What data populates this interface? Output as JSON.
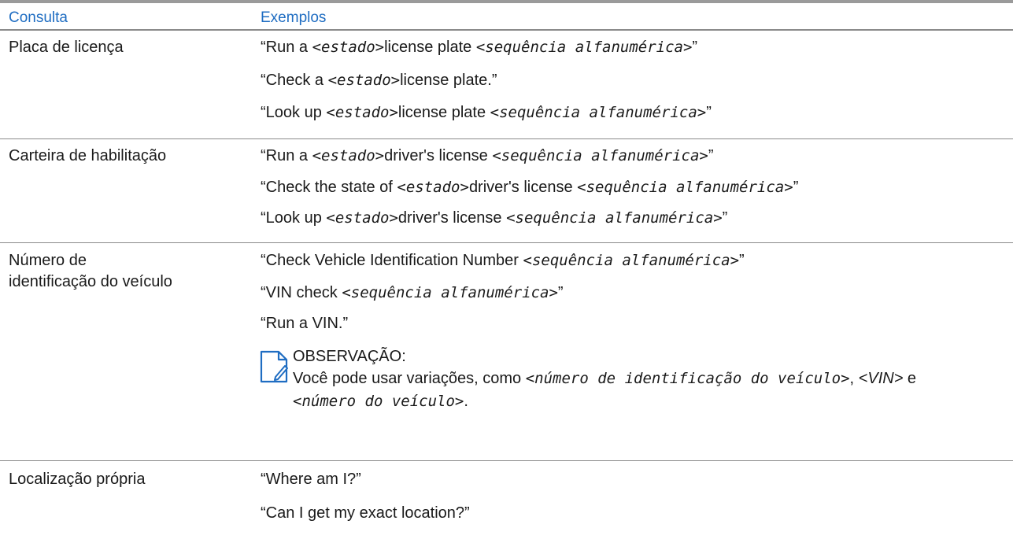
{
  "header": {
    "col1": "Consulta",
    "col2": "Exemplos"
  },
  "rows": [
    {
      "query": "Placa de licença",
      "examples": [
        {
          "pre": "“Run a ",
          "var1": "<estado>",
          "mid": "license plate ",
          "var2": "<sequência alfanumérica>",
          "post": "”"
        },
        {
          "pre": "“Check a ",
          "var1": "<estado>",
          "mid": "license plate.”"
        },
        {
          "pre": "“Look up ",
          "var1": "<estado>",
          "mid": "license plate ",
          "var2": "<sequência alfanumérica>",
          "post": "”"
        }
      ]
    },
    {
      "query": "Carteira de habilitação",
      "examples": [
        {
          "pre": "“Run a ",
          "var1": "<estado>",
          "mid": "driver's license ",
          "var2": "<sequência alfanumérica>",
          "post": "”"
        },
        {
          "pre": "“Check the state of ",
          "var1": "<estado>",
          "mid": "driver's license ",
          "var2": "<sequência alfanumérica>",
          "post": "”"
        },
        {
          "pre": "“Look up ",
          "var1": "<estado>",
          "mid": "driver's license ",
          "var2": "<sequência alfanumérica>",
          "post": "”"
        }
      ]
    },
    {
      "query_line1": "Número de",
      "query_line2": "identificação do veículo",
      "examples": [
        {
          "pre": "“Check Vehicle Identification Number ",
          "var2": "<sequência alfanumérica>",
          "post": "”"
        },
        {
          "pre": "“VIN check ",
          "var2": "<sequência alfanumérica>",
          "post": "”"
        },
        {
          "pre": "“Run a VIN.”"
        }
      ],
      "note": {
        "icon": "note-icon",
        "title": "OBSERVAÇÃO:",
        "text_pre": "Você pode usar variações, como ",
        "var_a": "<número de identificação do veículo>",
        "sep1": ", ",
        "var_b": "<VIN>",
        "sep2": " e ",
        "var_c": "<número do veículo>",
        "text_post": "."
      }
    },
    {
      "query": "Localização própria",
      "examples": [
        {
          "pre": "“Where am I?”"
        },
        {
          "pre": "“Can I get my exact location?”"
        }
      ]
    }
  ]
}
